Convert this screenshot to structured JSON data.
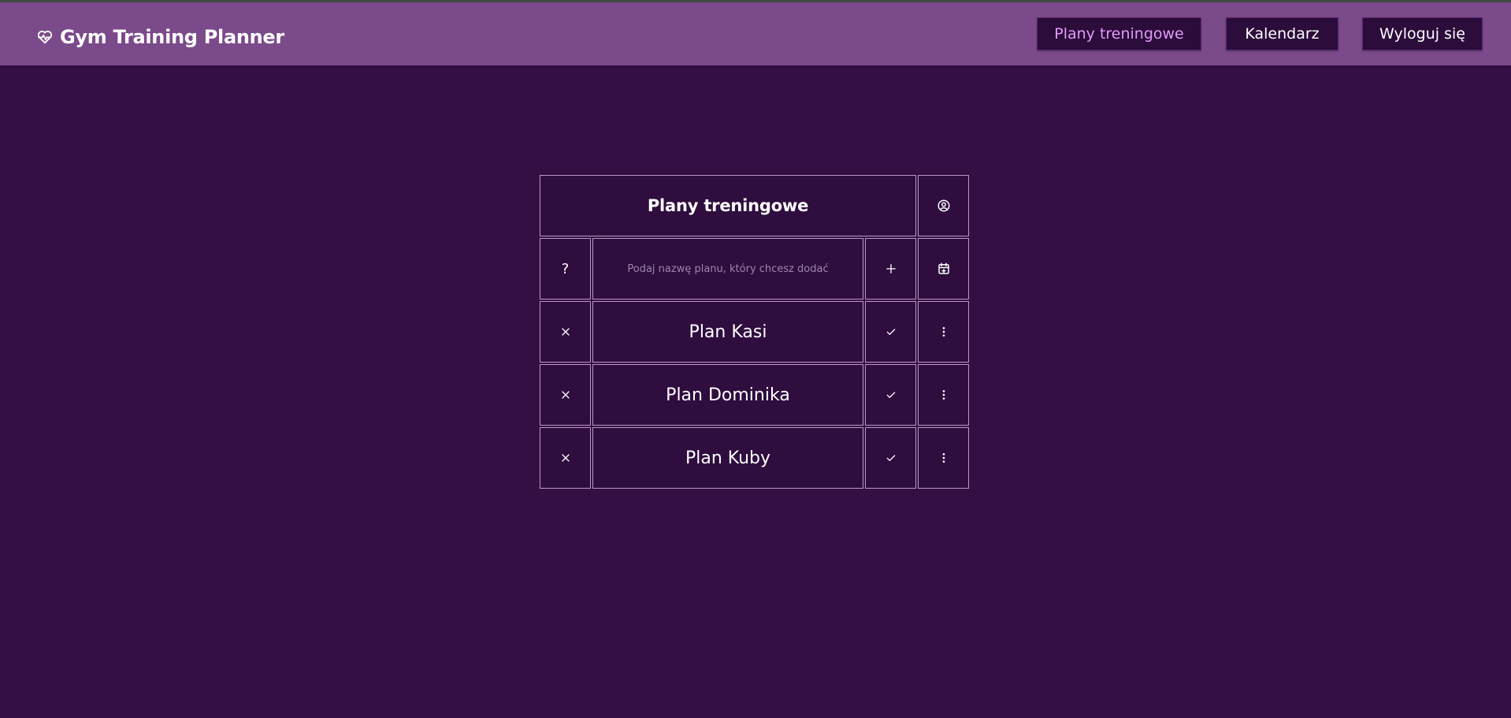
{
  "app": {
    "title": "Gym Training Planner",
    "logo_icon": "heart-pulse-icon"
  },
  "nav": {
    "plans_label": "Plany treningowe",
    "calendar_label": "Kalendarz",
    "logout_label": "Wyloguj się",
    "active": "plans"
  },
  "panel": {
    "title": "Plany treningowe",
    "profile_icon": "user-circle-icon",
    "help_label": "?",
    "input": {
      "placeholder": "Podaj nazwę planu, który chcesz dodać",
      "value": ""
    },
    "add_icon": "plus-icon",
    "calendar_add_icon": "calendar-plus-icon",
    "plans": [
      {
        "name": "Plan Kasi"
      },
      {
        "name": "Plan Dominika"
      },
      {
        "name": "Plan Kuby"
      }
    ]
  },
  "colors": {
    "background": "#340f44",
    "navbar": "#7b4a8b",
    "button_bg": "#2b0c3b",
    "active_nav_text": "#e39bf7",
    "cell_border": "#b89ac4"
  }
}
